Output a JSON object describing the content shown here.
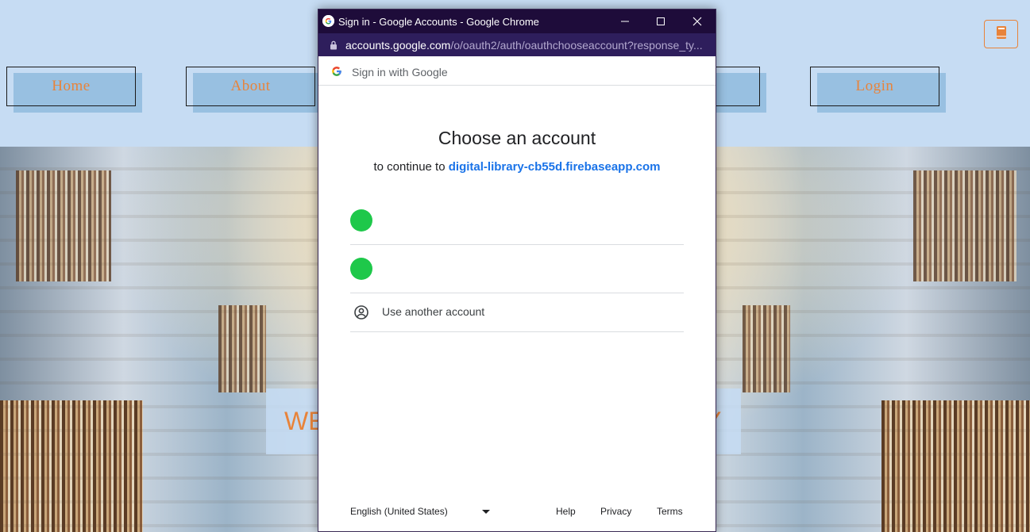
{
  "site": {
    "nav": [
      {
        "label": "Home"
      },
      {
        "label": "About"
      },
      {
        "label": ""
      },
      {
        "label": "Login"
      }
    ],
    "welcome_visible_start": "WE",
    "welcome_visible_end": "Y"
  },
  "popup": {
    "window_title": "Sign in - Google Accounts - Google Chrome",
    "url_host": "accounts.google.com",
    "url_path": "/o/oauth2/auth/oauthchooseaccount?response_ty...",
    "signin_bar": "Sign in with Google",
    "heading": "Choose an account",
    "subheading_prefix": "to continue to",
    "app_domain": "digital-library-cb55d.firebaseapp.com",
    "use_another": "Use another account",
    "footer": {
      "language": "English (United States)",
      "help": "Help",
      "privacy": "Privacy",
      "terms": "Terms"
    }
  },
  "colors": {
    "accent_orange": "#e8833a",
    "header_bg": "#c6dcf3",
    "avatar_green": "#1ec84a",
    "link_blue": "#1a73e8"
  }
}
